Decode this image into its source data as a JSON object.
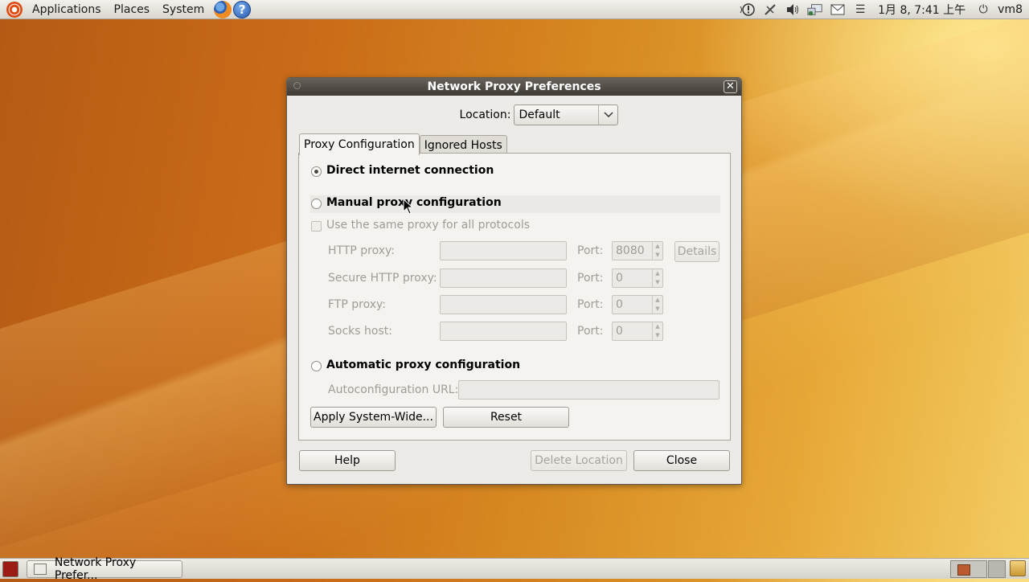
{
  "top_panel": {
    "menus": [
      "Applications",
      "Places",
      "System"
    ],
    "help_glyph": "?",
    "tray_icons": [
      "alert-icon",
      "network-disconnected-icon",
      "volume-icon",
      "network-icon",
      "mail-icon"
    ],
    "menu_glyph": "☰",
    "clock": "1月  8,  7:41 上午",
    "power_glyph": "⏻",
    "user": "vm8"
  },
  "dialog": {
    "title": "Network Proxy Preferences",
    "close_glyph": "✕",
    "location_label": "Location:",
    "location_value": "Default",
    "tabs": [
      "Proxy Configuration",
      "Ignored Hosts"
    ],
    "direct_label": "Direct internet connection",
    "manual_label": "Manual proxy configuration",
    "same_proxy_label": "Use the same proxy for all protocols",
    "fields": [
      {
        "label": "HTTP proxy:",
        "port_label": "Port:",
        "port": "8080"
      },
      {
        "label": "Secure HTTP proxy:",
        "port_label": "Port:",
        "port": "0"
      },
      {
        "label": "FTP proxy:",
        "port_label": "Port:",
        "port": "0"
      },
      {
        "label": "Socks host:",
        "port_label": "Port:",
        "port": "0"
      }
    ],
    "details_label": "Details",
    "auto_label": "Automatic proxy configuration",
    "autoconfig_label": "Autoconfiguration URL:",
    "apply_label": "Apply System-Wide...",
    "reset_label": "Reset",
    "help_label": "Help",
    "delete_label": "Delete Location",
    "close_label": "Close"
  },
  "bottom_panel": {
    "task_label": "Network Proxy Prefer..."
  }
}
